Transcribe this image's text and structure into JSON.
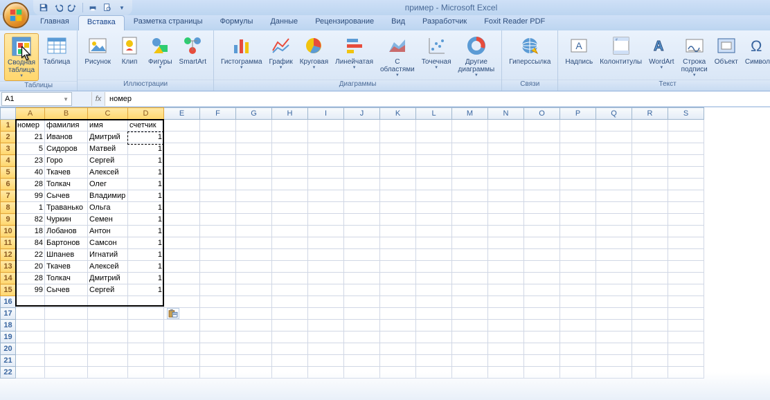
{
  "title": "пример - Microsoft Excel",
  "tabs": [
    "Главная",
    "Вставка",
    "Разметка страницы",
    "Формулы",
    "Данные",
    "Рецензирование",
    "Вид",
    "Разработчик",
    "Foxit Reader PDF"
  ],
  "activeTab": 1,
  "ribbon_groups": [
    {
      "label": "Таблицы",
      "buttons": [
        {
          "key": "pivot",
          "label": "Сводная\nтаблица",
          "drop": true,
          "hl": true,
          "icon": "pivot"
        },
        {
          "key": "table",
          "label": "Таблица",
          "icon": "table"
        }
      ]
    },
    {
      "label": "Иллюстрации",
      "buttons": [
        {
          "key": "picture",
          "label": "Рисунок",
          "icon": "picture"
        },
        {
          "key": "clip",
          "label": "Клип",
          "icon": "clip"
        },
        {
          "key": "shapes",
          "label": "Фигуры",
          "drop": true,
          "icon": "shapes"
        },
        {
          "key": "smartart",
          "label": "SmartArt",
          "icon": "smartart"
        }
      ]
    },
    {
      "label": "Диаграммы",
      "buttons": [
        {
          "key": "col",
          "label": "Гистограмма",
          "drop": true,
          "icon": "colchart"
        },
        {
          "key": "line",
          "label": "График",
          "drop": true,
          "icon": "linechart"
        },
        {
          "key": "pie",
          "label": "Круговая",
          "drop": true,
          "icon": "piechart"
        },
        {
          "key": "bar",
          "label": "Линейчатая",
          "drop": true,
          "icon": "barchart"
        },
        {
          "key": "area",
          "label": "С\nобластями",
          "drop": true,
          "icon": "areachart"
        },
        {
          "key": "scatter",
          "label": "Точечная",
          "drop": true,
          "icon": "scatterchart"
        },
        {
          "key": "other",
          "label": "Другие\nдиаграммы",
          "drop": true,
          "icon": "otherchart"
        }
      ]
    },
    {
      "label": "Связи",
      "buttons": [
        {
          "key": "hyper",
          "label": "Гиперссылка",
          "icon": "hyperlink"
        }
      ]
    },
    {
      "label": "Текст",
      "buttons": [
        {
          "key": "textbox",
          "label": "Надпись",
          "icon": "textbox"
        },
        {
          "key": "headfoot",
          "label": "Колонтитулы",
          "icon": "headfoot"
        },
        {
          "key": "wordart",
          "label": "WordArt",
          "drop": true,
          "icon": "wordart"
        },
        {
          "key": "sig",
          "label": "Строка\nподписи",
          "drop": true,
          "icon": "sig"
        },
        {
          "key": "object",
          "label": "Объект",
          "icon": "object"
        },
        {
          "key": "symbol",
          "label": "Символ",
          "icon": "symbol"
        }
      ]
    }
  ],
  "namebox": "A1",
  "formula": "номер",
  "columns": [
    "A",
    "B",
    "C",
    "D",
    "E",
    "F",
    "G",
    "H",
    "I",
    "J",
    "K",
    "L",
    "M",
    "N",
    "O",
    "P",
    "Q",
    "R",
    "S"
  ],
  "selectedCols": [
    "A",
    "B",
    "C",
    "D"
  ],
  "selectedRows": [
    1,
    2,
    3,
    4,
    5,
    6,
    7,
    8,
    9,
    10,
    11,
    12,
    13,
    14,
    15
  ],
  "headers": [
    "номер",
    "фамилия",
    "имя",
    "счетчик"
  ],
  "rows": [
    [
      21,
      "Иванов",
      "Дмитрий",
      1
    ],
    [
      5,
      "Сидоров",
      "Матвей",
      1
    ],
    [
      23,
      "Горо",
      "Сергей",
      1
    ],
    [
      40,
      "Ткачев",
      "Алексей",
      1
    ],
    [
      28,
      "Толкач",
      "Олег",
      1
    ],
    [
      99,
      "Сычев",
      "Владимир",
      1
    ],
    [
      1,
      "Траванько",
      "Ольга",
      1
    ],
    [
      82,
      "Чуркин",
      "Семен",
      1
    ],
    [
      18,
      "Лобанов",
      "Антон",
      1
    ],
    [
      84,
      "Бартонов",
      "Самсон",
      1
    ],
    [
      22,
      "Шпанев",
      "Игнатий",
      1
    ],
    [
      20,
      "Ткачев",
      "Алексей",
      1
    ],
    [
      28,
      "Толкач",
      "Дмитрий",
      1
    ],
    [
      99,
      "Сычев",
      "Сергей",
      1
    ]
  ],
  "totalRows": 22,
  "fx_label": "fx"
}
